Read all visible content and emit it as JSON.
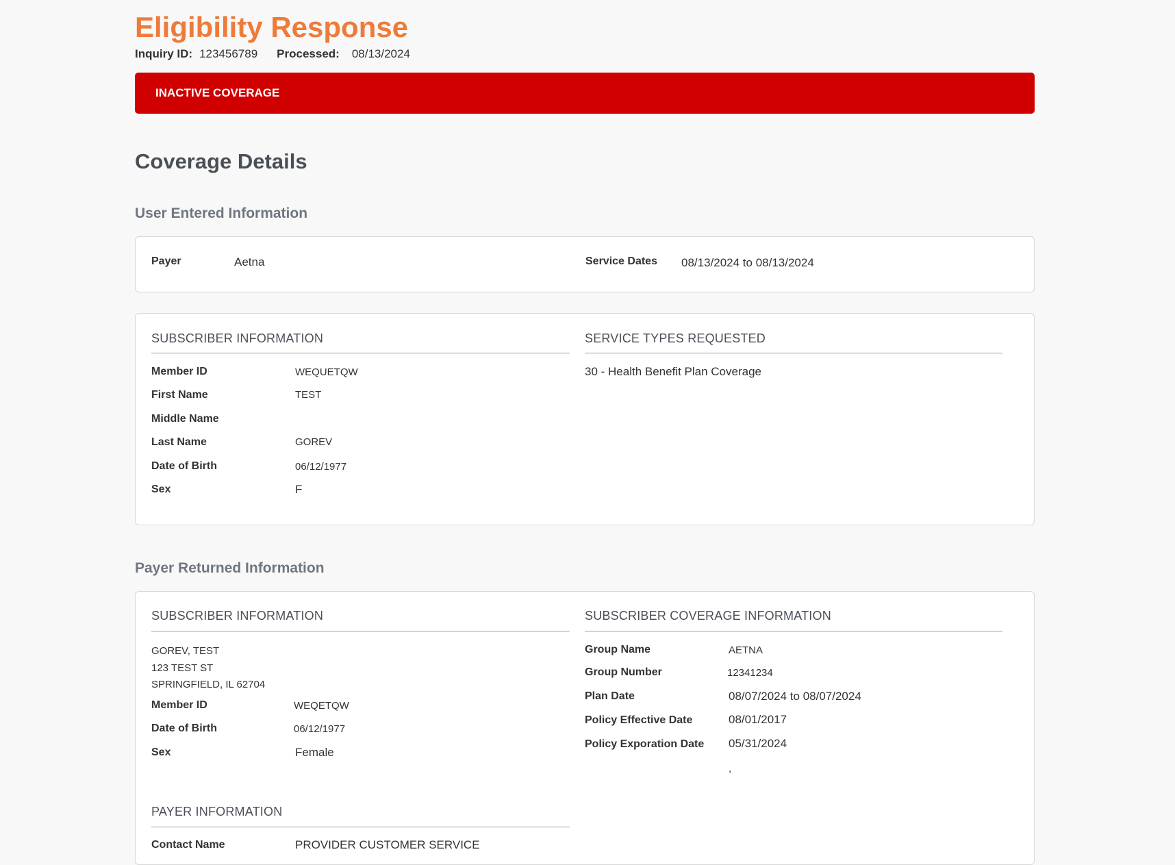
{
  "header": {
    "title": "Eligibility Response",
    "inquiry_label": "Inquiry ID:",
    "inquiry_value": "123456789",
    "processed_label": "Processed:",
    "processed_value": "08/13/2024"
  },
  "status_banner": {
    "text": "INACTIVE COVERAGE",
    "color": "#d00000"
  },
  "coverage": {
    "title": "Coverage Details",
    "user_entered": {
      "title": "User Entered Information",
      "payer_label": "Payer",
      "payer_value": "Aetna",
      "service_dates_label": "Service Dates",
      "service_dates_value": "08/13/2024 to 08/13/2024",
      "subscriber": {
        "heading": "SUBSCRIBER INFORMATION",
        "fields": [
          {
            "label": "Member ID",
            "value": "WEQUETQW"
          },
          {
            "label": "First Name",
            "value": "TEST"
          },
          {
            "label": "Middle Name",
            "value": ""
          },
          {
            "label": "Last Name",
            "value": "GOREV"
          },
          {
            "label": "Date of Birth",
            "value": "06/12/1977"
          },
          {
            "label": "Sex",
            "value": "F"
          }
        ]
      },
      "service_types": {
        "heading": "SERVICE TYPES REQUESTED",
        "items": [
          "30 - Health Benefit Plan Coverage"
        ]
      }
    },
    "payer_returned": {
      "title": "Payer Returned Information",
      "subscriber": {
        "heading": "SUBSCRIBER INFORMATION",
        "address": [
          "GOREV, TEST",
          "123 TEST ST",
          "SPRINGFIELD, IL 62704"
        ],
        "fields": [
          {
            "label": "Member ID",
            "value": "WEQETQW"
          },
          {
            "label": "Date of Birth",
            "value": "06/12/1977"
          },
          {
            "label": "Sex",
            "value": "Female"
          }
        ]
      },
      "coverage_info": {
        "heading": "SUBSCRIBER COVERAGE INFORMATION",
        "fields": [
          {
            "label": "Group Name",
            "value": "AETNA"
          },
          {
            "label": "Group Number",
            "value": "12341234"
          },
          {
            "label": "Plan Date",
            "value": "08/07/2024 to 08/07/2024"
          },
          {
            "label": "Policy Effective Date",
            "value": "08/01/2017"
          },
          {
            "label": "Policy Exporation Date",
            "value": "05/31/2024"
          }
        ],
        "trailing": ","
      },
      "payer_info": {
        "heading": "PAYER INFORMATION",
        "contact_label": "Contact Name",
        "contact_value": "PROVIDER CUSTOMER SERVICE"
      }
    }
  }
}
